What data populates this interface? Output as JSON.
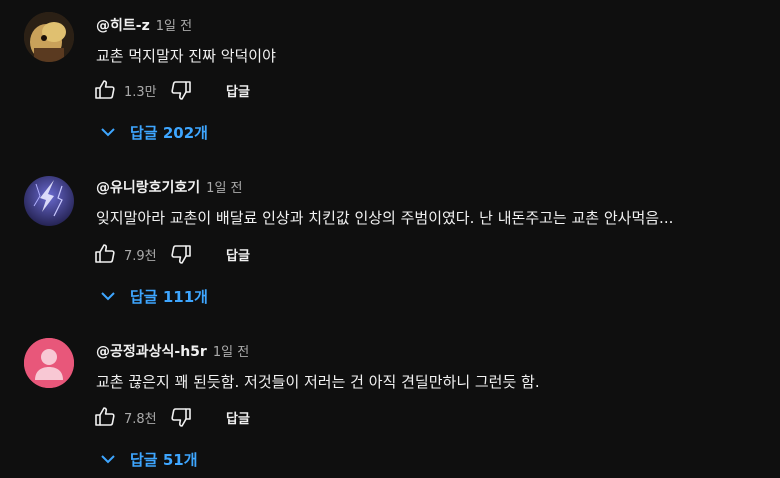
{
  "comments": [
    {
      "author": "@히트-z",
      "time": "1일 전",
      "text": "교촌 먹지말자 진짜 악덕이야",
      "likes": "1.3만",
      "reply_label": "답글",
      "replies_label": "답글 202개",
      "avatar_icon": "avatar-photo-icon"
    },
    {
      "author": "@유니랑호기호기",
      "time": "1일 전",
      "text": "잊지말아라 교촌이 배달료 인상과 치킨값 인상의 주범이였다. 난 내돈주고는 교촌 안사먹음...",
      "likes": "7.9천",
      "reply_label": "답글",
      "replies_label": "답글 111개",
      "avatar_icon": "avatar-lightning-icon"
    },
    {
      "author": "@공정과상식-h5r",
      "time": "1일 전",
      "text": "교촌 끊은지 꽤 된듯함. 저것들이 저러는 건 아직 견딜만하니 그런듯 함.",
      "likes": "7.8천",
      "reply_label": "답글",
      "replies_label": "답글 51개",
      "avatar_icon": "avatar-default-person-icon"
    }
  ],
  "colors": {
    "background": "#0f0f0f",
    "text": "#f1f1f1",
    "secondary": "#aaaaaa",
    "link": "#3ea6ff",
    "default_avatar": "#e8577a"
  }
}
